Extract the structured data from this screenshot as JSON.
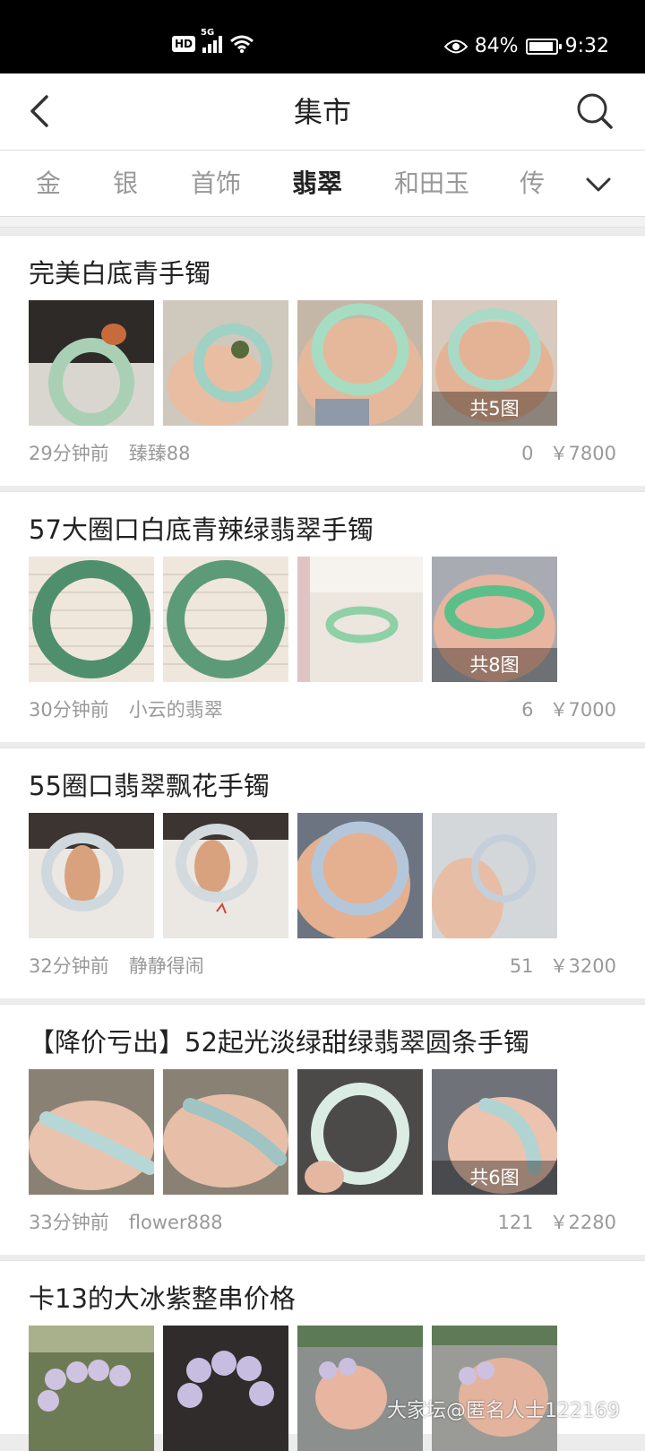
{
  "status_bar": {
    "hd": "HD",
    "network": "5G",
    "battery_percent": "84%",
    "time": "9:32"
  },
  "header": {
    "title": "集市"
  },
  "tabs": [
    {
      "label": "金",
      "active": false
    },
    {
      "label": "银",
      "active": false
    },
    {
      "label": "首饰",
      "active": false
    },
    {
      "label": "翡翠",
      "active": true
    },
    {
      "label": "和田玉",
      "active": false
    },
    {
      "label": "传",
      "active": false
    }
  ],
  "listings": [
    {
      "title": "完美白底青手镯",
      "image_count_label": "共5图",
      "time": "29分钟前",
      "author": "臻臻88",
      "likes": "0",
      "price": "￥7800"
    },
    {
      "title": "57大圈口白底青辣绿翡翠手镯",
      "image_count_label": "共8图",
      "time": "30分钟前",
      "author": "小云的翡翠",
      "likes": "6",
      "price": "￥7000"
    },
    {
      "title": "55圈口翡翠飘花手镯",
      "image_count_label": "",
      "time": "32分钟前",
      "author": "静静得闹",
      "likes": "51",
      "price": "￥3200"
    },
    {
      "title": "【降价亏出】52起光淡绿甜绿翡翠圆条手镯",
      "image_count_label": "共6图",
      "time": "33分钟前",
      "author": "flower888",
      "likes": "121",
      "price": "￥2280"
    },
    {
      "title": "卡13的大冰紫整串价格",
      "image_count_label": "",
      "time": "",
      "author": "",
      "likes": "",
      "price": ""
    }
  ],
  "watermark": "大家坛@匿名人士122169",
  "colors": {
    "text_primary": "#222222",
    "text_secondary": "#999999",
    "background": "#ececec"
  }
}
